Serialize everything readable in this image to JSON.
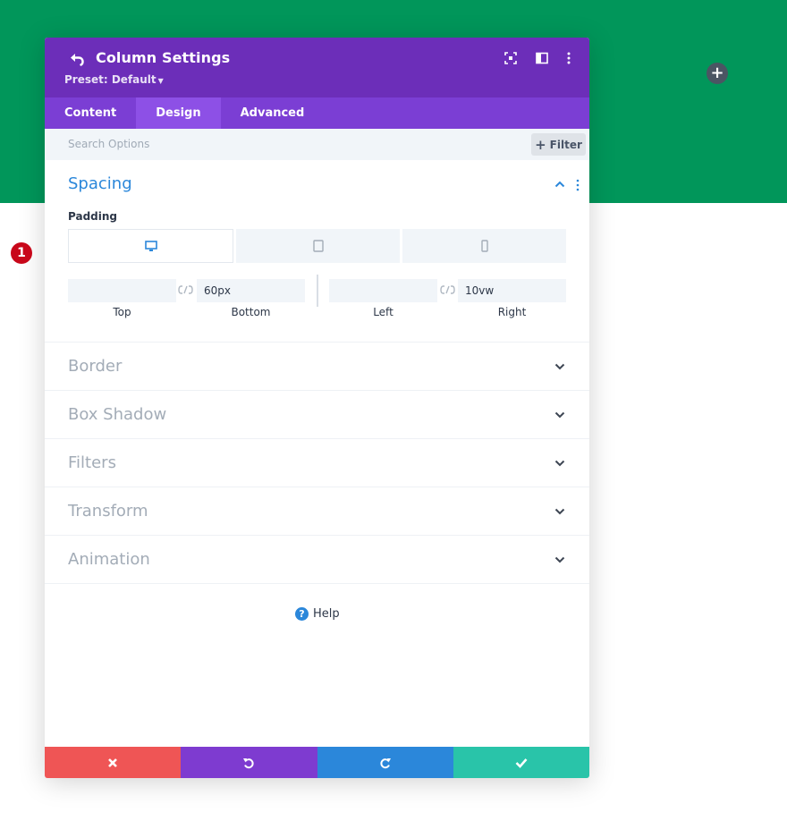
{
  "header": {
    "title": "Column Settings",
    "preset_label": "Preset: Default",
    "back_icon": "undo-arrow-icon",
    "icons": [
      "fullscreen-icon",
      "split-view-icon",
      "kebab-menu-icon"
    ]
  },
  "tabs": [
    {
      "label": "Content",
      "active": false
    },
    {
      "label": "Design",
      "active": true
    },
    {
      "label": "Advanced",
      "active": false
    }
  ],
  "search": {
    "placeholder": "Search Options",
    "filter_label": "Filter"
  },
  "spacing": {
    "title": "Spacing",
    "padding_label": "Padding",
    "devices": [
      "desktop-icon",
      "tablet-icon",
      "phone-icon"
    ],
    "fields": [
      {
        "label": "Top",
        "value": ""
      },
      {
        "label": "Bottom",
        "value": "60px"
      },
      {
        "label": "Left",
        "value": ""
      },
      {
        "label": "Right",
        "value": "10vw"
      }
    ],
    "badge": "1"
  },
  "sections": [
    {
      "title": "Border"
    },
    {
      "title": "Box Shadow"
    },
    {
      "title": "Filters"
    },
    {
      "title": "Transform"
    },
    {
      "title": "Animation"
    }
  ],
  "help_label": "Help",
  "colors": {
    "header": "#6c2eb9",
    "tabs": "#7b3ed4",
    "active_tab": "#8d50e6",
    "background_green": "#01965a",
    "cancel": "#ef5555",
    "undo": "#7e3bd0",
    "redo": "#2b87da",
    "save": "#29c4a9"
  }
}
